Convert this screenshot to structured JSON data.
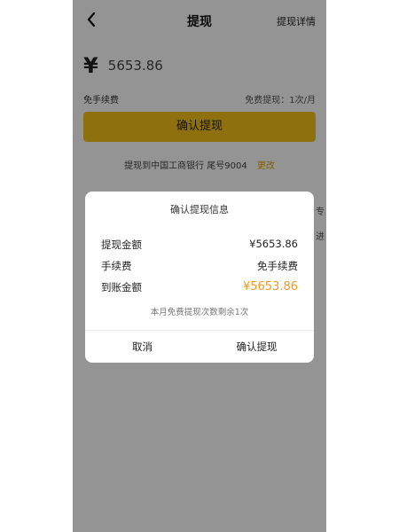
{
  "header": {
    "title": "提现",
    "detail_link": "提现详情"
  },
  "amount": {
    "currency_symbol": "¥",
    "value": "5653.86"
  },
  "fee": {
    "left": "免手续费",
    "right": "免费提现：1次/月"
  },
  "primary_button": "确认提现",
  "bank": {
    "text": "提现到中国工商银行 尾号9004",
    "change_label": "更改"
  },
  "background_fragments": {
    "row1": "专",
    "row2": "进"
  },
  "dialog": {
    "title": "确认提现信息",
    "rows": [
      {
        "label": "提现金额",
        "value": "¥5653.86"
      },
      {
        "label": "手续费",
        "value": "免手续费"
      },
      {
        "label": "到账金额",
        "value": "¥5653.86"
      }
    ],
    "note": "本月免费提现次数剩余1次",
    "cancel": "取消",
    "confirm": "确认提现"
  },
  "colors": {
    "primary_yellow": "#f5c21b",
    "accent_orange": "#f39a1e",
    "mask": "rgba(0,0,0,0.42)"
  }
}
